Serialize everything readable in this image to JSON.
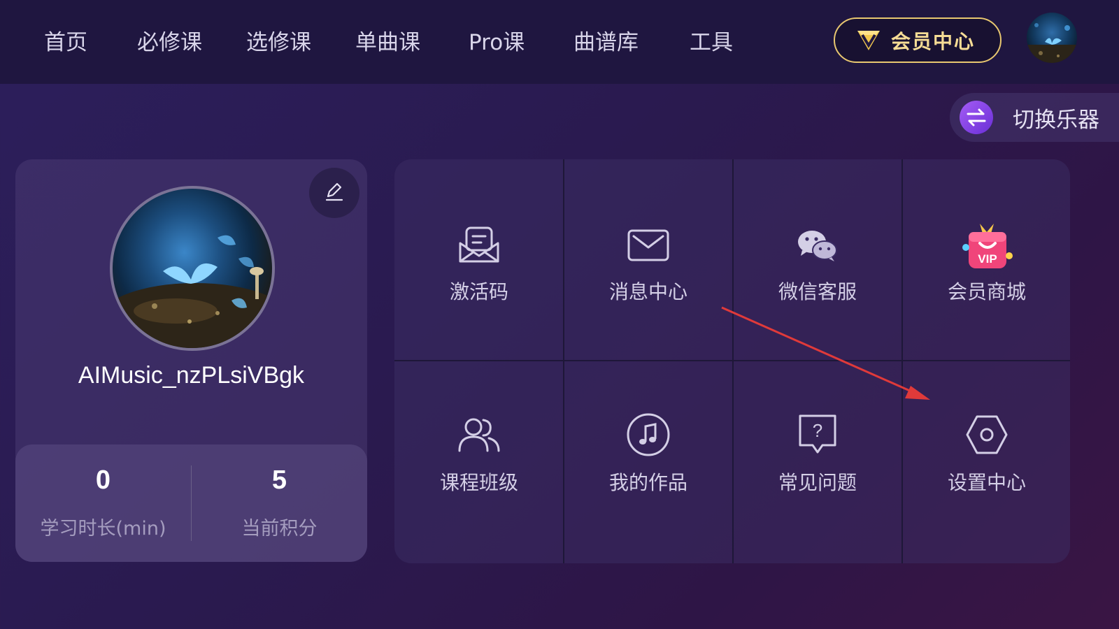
{
  "nav": {
    "items": [
      {
        "label": "首页"
      },
      {
        "label": "必修课"
      },
      {
        "label": "选修课"
      },
      {
        "label": "单曲课"
      },
      {
        "label": "Pro课"
      },
      {
        "label": "曲谱库"
      },
      {
        "label": "工具"
      }
    ],
    "vip_label": "会员中心"
  },
  "switch_instrument": {
    "label": "切换乐器"
  },
  "profile": {
    "username": "AIMusic_nzPLsiVBgk",
    "stats": [
      {
        "value": "0",
        "label": "学习时长(min)"
      },
      {
        "value": "5",
        "label": "当前积分"
      }
    ]
  },
  "grid": {
    "tiles": [
      {
        "label": "激活码",
        "icon": "activation-code-icon"
      },
      {
        "label": "消息中心",
        "icon": "envelope-icon"
      },
      {
        "label": "微信客服",
        "icon": "wechat-icon"
      },
      {
        "label": "会员商城",
        "icon": "vip-gift-icon"
      },
      {
        "label": "课程班级",
        "icon": "users-icon"
      },
      {
        "label": "我的作品",
        "icon": "music-note-icon"
      },
      {
        "label": "常见问题",
        "icon": "question-icon"
      },
      {
        "label": "设置中心",
        "icon": "settings-hexagon-icon"
      }
    ]
  },
  "colors": {
    "accent_gold": "#f6dc95",
    "annotation_arrow": "#e03a3a",
    "switch_purple": "#8a45e6"
  }
}
